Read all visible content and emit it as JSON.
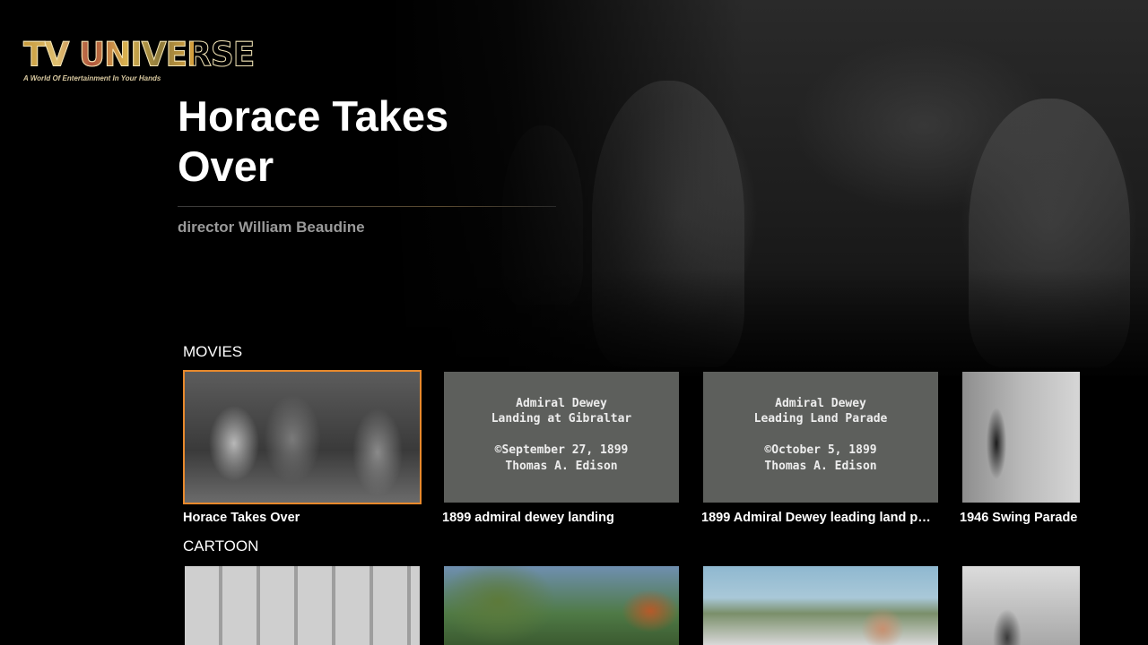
{
  "brand": {
    "logo_word": "TV UNIVERSE",
    "tagline": "A World Of Entertainment In Your Hands"
  },
  "hero": {
    "title": "Horace Takes Over",
    "subtitle": "director William Beaudine"
  },
  "rows": [
    {
      "title": "MOVIES",
      "items": [
        {
          "label": "Horace Takes Over",
          "thumb": "film-still",
          "focused": true
        },
        {
          "label": "1899 admiral dewey landing",
          "thumb": "title-card",
          "card_text": [
            "Admiral Dewey",
            "Landing at Gibraltar",
            "©September 27, 1899",
            "Thomas A. Edison"
          ]
        },
        {
          "label": "1899 Admiral Dewey leading land par...",
          "thumb": "title-card",
          "card_text": [
            "Admiral Dewey",
            "Leading Land Parade",
            "©October 5, 1899",
            "Thomas A. Edison"
          ]
        },
        {
          "label": "1946 Swing Parade",
          "thumb": "film-still"
        }
      ]
    },
    {
      "title": "CARTOON",
      "items": [
        {
          "thumb": "cartoon"
        },
        {
          "thumb": "cartoon"
        },
        {
          "thumb": "cartoon"
        },
        {
          "thumb": "cartoon"
        }
      ]
    }
  ],
  "colors": {
    "focus_outline": "#e8892c",
    "background": "#000000",
    "subtitle_text": "#9a9a9a"
  }
}
